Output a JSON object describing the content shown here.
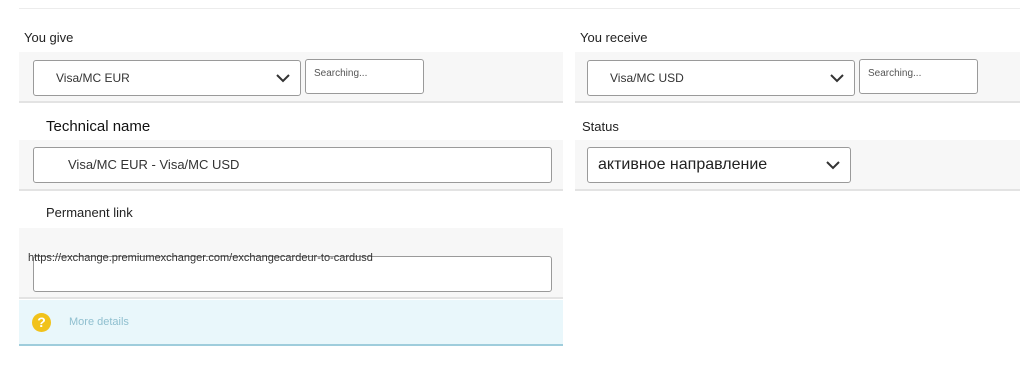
{
  "give": {
    "label": "You give",
    "currency_value": "Visa/MC EUR",
    "search_placeholder": "Searching..."
  },
  "receive": {
    "label": "You receive",
    "currency_value": "Visa/MC USD",
    "search_placeholder": "Searching..."
  },
  "technical": {
    "label": "Technical name",
    "value": "Visa/MC EUR - Visa/MC USD"
  },
  "status": {
    "label": "Status",
    "value": "активное направление"
  },
  "permalink": {
    "label": "Permanent link",
    "value": "https://exchange.premiumexchanger.com/exchangecardeur-to-cardusd"
  },
  "more_details": {
    "label": "More details",
    "icon": "question-icon",
    "icon_color": "#f1c21b"
  }
}
